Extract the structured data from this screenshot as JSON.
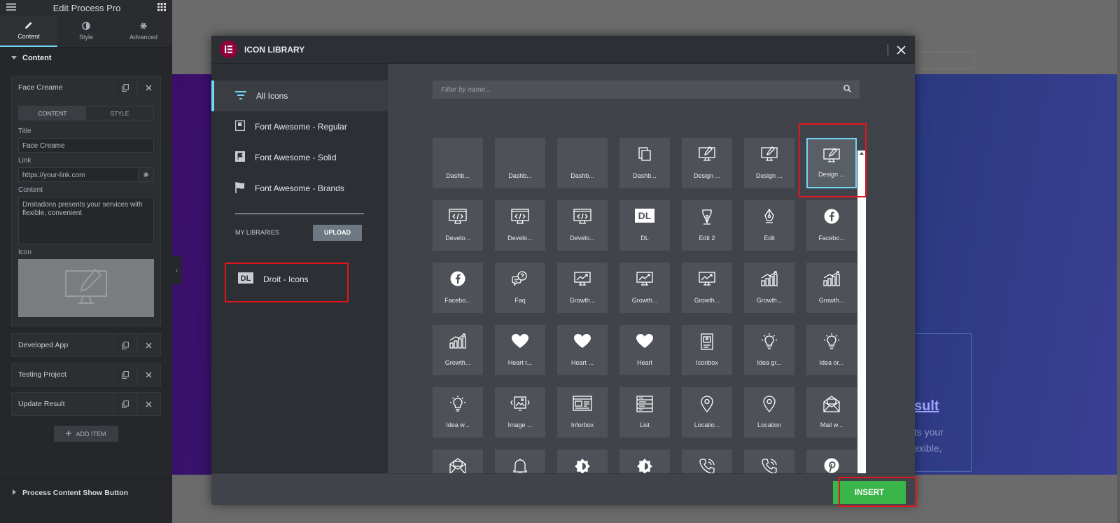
{
  "editor": {
    "title": "Edit Process Pro",
    "tabs": [
      {
        "label": "Content"
      },
      {
        "label": "Style"
      },
      {
        "label": "Advanced"
      }
    ],
    "section_label": "Content",
    "item": {
      "label": "Face Creame",
      "subtabs": [
        "CONTENT",
        "STYLE"
      ],
      "title_label": "Title",
      "title_value": "Face Creame",
      "link_label": "Link",
      "link_placeholder": "https://your-link.com",
      "content_label": "Content",
      "content_value": "Droitadons presents your services with flexible, convenient",
      "icon_label": "Icon"
    },
    "collapsed_items": [
      "Developed App",
      "Testing Project",
      "Update Result"
    ],
    "add_item_label": "ADD ITEM",
    "footer_section": "Process Content Show Button"
  },
  "preview": {
    "heading_partial": "sult",
    "text_partial": [
      "nts your",
      "flexible,",
      "t"
    ]
  },
  "modal": {
    "title": "ICON LIBRARY",
    "categories": [
      {
        "label": "All Icons",
        "icon": "filter-icon",
        "active": true
      },
      {
        "label": "Font Awesome - Regular",
        "icon": "flag-regular-icon"
      },
      {
        "label": "Font Awesome - Solid",
        "icon": "flag-solid-icon"
      },
      {
        "label": "Font Awesome - Brands",
        "icon": "flag-brands-icon"
      }
    ],
    "my_libraries_label": "MY LIBRARIES",
    "upload_label": "UPLOAD",
    "custom_library": {
      "badge": "DL",
      "label": "Droit - Icons"
    },
    "search_placeholder": "Filter by name...",
    "insert_label": "INSERT",
    "selected_icon_index": 6,
    "icons": [
      {
        "name": "Dashb...",
        "icon": "blank"
      },
      {
        "name": "Dashb...",
        "icon": "blank"
      },
      {
        "name": "Dashb...",
        "icon": "blank"
      },
      {
        "name": "Dashb...",
        "icon": "copy"
      },
      {
        "name": "Design ...",
        "icon": "monitor-pen"
      },
      {
        "name": "Design ...",
        "icon": "monitor-pen"
      },
      {
        "name": "Design ...",
        "icon": "monitor-pen"
      },
      {
        "name": "Develo...",
        "icon": "code-window"
      },
      {
        "name": "Develo...",
        "icon": "code-window"
      },
      {
        "name": "Develo...",
        "icon": "code-window"
      },
      {
        "name": "DL",
        "icon": "dl-badge"
      },
      {
        "name": "Edit 2",
        "icon": "pen-nib"
      },
      {
        "name": "Edit",
        "icon": "pen-nib-2"
      },
      {
        "name": "Facebo...",
        "icon": "facebook"
      },
      {
        "name": "Facebo...",
        "icon": "facebook"
      },
      {
        "name": "Faq",
        "icon": "faq"
      },
      {
        "name": "Growth...",
        "icon": "growth-monitor"
      },
      {
        "name": "Growth...",
        "icon": "growth-monitor"
      },
      {
        "name": "Growth...",
        "icon": "growth-monitor"
      },
      {
        "name": "Growth...",
        "icon": "growth-bars"
      },
      {
        "name": "Growth...",
        "icon": "growth-bars"
      },
      {
        "name": "Growth...",
        "icon": "growth-bars"
      },
      {
        "name": "Heart r...",
        "icon": "heart"
      },
      {
        "name": "Heart ...",
        "icon": "heart"
      },
      {
        "name": "Heart",
        "icon": "heart"
      },
      {
        "name": "Iconbox",
        "icon": "iconbox"
      },
      {
        "name": "Idea gr...",
        "icon": "bulb"
      },
      {
        "name": "Idea or...",
        "icon": "bulb"
      },
      {
        "name": "Idea w...",
        "icon": "bulb"
      },
      {
        "name": "Image ...",
        "icon": "image"
      },
      {
        "name": "Inforbox",
        "icon": "inforbox"
      },
      {
        "name": "List",
        "icon": "list"
      },
      {
        "name": "Locatio...",
        "icon": "location"
      },
      {
        "name": "Location",
        "icon": "location"
      },
      {
        "name": "Mail w...",
        "icon": "mail"
      },
      {
        "name": "",
        "icon": "mail"
      },
      {
        "name": "",
        "icon": "bell"
      },
      {
        "name": "",
        "icon": "brightness"
      },
      {
        "name": "",
        "icon": "brightness"
      },
      {
        "name": "",
        "icon": "phone"
      },
      {
        "name": "",
        "icon": "phone"
      },
      {
        "name": "",
        "icon": "pinterest"
      }
    ]
  }
}
